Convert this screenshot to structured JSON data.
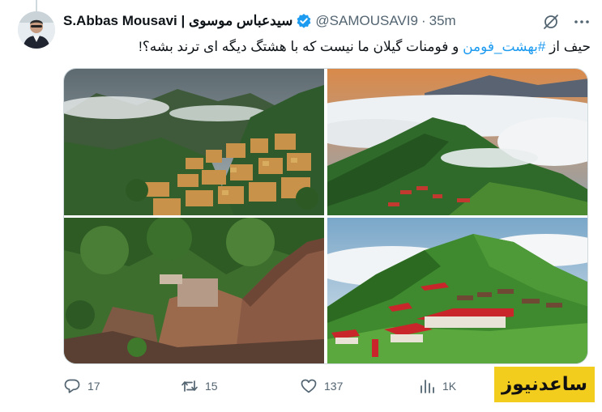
{
  "tweet": {
    "display_name": "S.Abbas Mousavi | سیدعباس موسوی",
    "verified": true,
    "handle": "@SAMOUSAVI9",
    "separator": "·",
    "time": "35m",
    "text_before": "حیف از ",
    "hashtag": "#بهشت_فومن",
    "text_after": " و فومنات گیلان ما نیست که با هشتگ دیگه ای ترند بشه؟!"
  },
  "media": [
    {
      "name": "masuleh-village-photo",
      "subject": "mountain village with foggy hills"
    },
    {
      "name": "mountain-clouds-photo",
      "subject": "green mountain ridge above clouds"
    },
    {
      "name": "rudkhan-castle-photo",
      "subject": "stone castle ruins in forest"
    },
    {
      "name": "red-roof-cabins-photo",
      "subject": "red roof cabins on green hill"
    }
  ],
  "actions": {
    "replies": "17",
    "reposts": "15",
    "likes": "137",
    "views": "1K"
  },
  "watermark": {
    "text": "ساعدنیوز"
  },
  "colors": {
    "accent": "#1d9bf0",
    "muted": "#536471",
    "watermark_bg": "#f2cd1d"
  },
  "icons": [
    "grok-icon",
    "more-icon",
    "verified-badge-icon",
    "reply-icon",
    "repost-icon",
    "like-icon",
    "views-icon"
  ]
}
